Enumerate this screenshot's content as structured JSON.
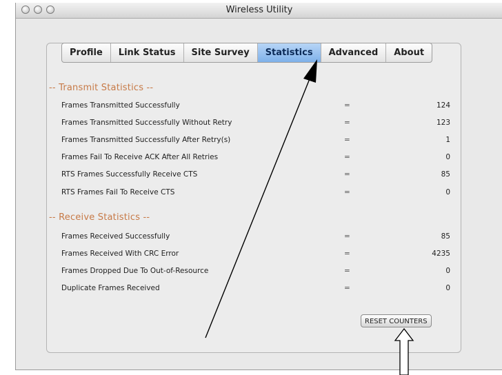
{
  "window": {
    "title": "Wireless Utility"
  },
  "tabs": [
    {
      "label": "Profile"
    },
    {
      "label": "Link Status"
    },
    {
      "label": "Site Survey"
    },
    {
      "label": "Statistics",
      "active": true
    },
    {
      "label": "Advanced"
    },
    {
      "label": "About"
    }
  ],
  "transmit": {
    "heading": "-- Transmit Statistics --",
    "rows": [
      {
        "label": "Frames Transmitted Successfully",
        "eq": "=",
        "value": "124"
      },
      {
        "label": "Frames Transmitted Successfully Without Retry",
        "eq": "=",
        "value": "123"
      },
      {
        "label": "Frames Transmitted Successfully After Retry(s)",
        "eq": "=",
        "value": "1"
      },
      {
        "label": "Frames Fail To Receive ACK After All Retries",
        "eq": "=",
        "value": "0"
      },
      {
        "label": "RTS Frames Successfully Receive CTS",
        "eq": "=",
        "value": "85"
      },
      {
        "label": "RTS Frames Fail To Receive CTS",
        "eq": "=",
        "value": "0"
      }
    ]
  },
  "receive": {
    "heading": "-- Receive Statistics --",
    "rows": [
      {
        "label": "Frames Received Successfully",
        "eq": "=",
        "value": "85"
      },
      {
        "label": "Frames Received With CRC Error",
        "eq": "=",
        "value": "4235"
      },
      {
        "label": "Frames Dropped Due To Out-of-Resource",
        "eq": "=",
        "value": "0"
      },
      {
        "label": "Duplicate Frames Received",
        "eq": "=",
        "value": "0"
      }
    ]
  },
  "buttons": {
    "reset_label": "RESET COUNTERS"
  },
  "colors": {
    "accent_tab": "#8fbcef",
    "section_heading": "#c77a47"
  }
}
